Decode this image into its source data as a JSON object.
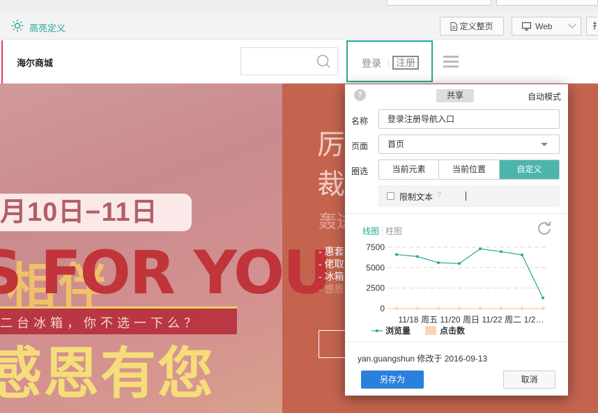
{
  "toolbar": {
    "highlight_label": "高亮定义",
    "define_page_label": "定义整页",
    "platform_label": "Web",
    "extra_label": "扌"
  },
  "site": {
    "logo_text": "海尔商城",
    "login_label": "登录",
    "register_label": "注册"
  },
  "banner": {
    "date_text": "月10日−11日",
    "slogan_en": "S FOR YOU",
    "slogan_cn_top": "相伴",
    "band_text": "二台冰箱，你不选一下么？",
    "slogan_cn_bottom": "感恩有您",
    "right_big1": "厉",
    "right_big2": "裁",
    "right_sub": "轰进",
    "right_list": [
      "- 惠套",
      "- 佬取",
      "- 冰箱",
      "- 感恩"
    ]
  },
  "popup": {
    "help_glyph": "?",
    "share_tab": "共享",
    "auto_mode": "自动模式",
    "name_label": "名称",
    "name_value": "登录注册导航入口",
    "page_label": "页面",
    "page_value": "首页",
    "select_label": "圈选",
    "segments": [
      "当前元素",
      "当前位置",
      "自定义"
    ],
    "limit_text_label": "限制文本",
    "limit_help": "?",
    "chart_tab_line": "线图",
    "chart_tab_bar": "柱图",
    "meta_text": "yan.guangshun 修改于 2016-09-13",
    "save_as_label": "另存为",
    "cancel_label": "取消"
  },
  "colors": {
    "accent": "#26a69a",
    "primary_button": "#2b7fdd",
    "line_series": "#26a69a",
    "bar_series": "#fbd3b4"
  },
  "chart_data": {
    "type": "line",
    "categories": [
      "11/18",
      "周五",
      "11/20",
      "周日",
      "11/22",
      "周二",
      "1/2…"
    ],
    "yticks": [
      0,
      2500,
      5000,
      7500
    ],
    "ylim": [
      0,
      8000
    ],
    "grid": true,
    "legend_placement": "bottom",
    "series": [
      {
        "name": "浏览量",
        "type": "line",
        "values": [
          6600,
          6350,
          5600,
          5500,
          7300,
          6950,
          6550,
          1300
        ]
      },
      {
        "name": "点击数",
        "type": "bar",
        "values": [
          0,
          0,
          0,
          0,
          0,
          0,
          0,
          0
        ]
      }
    ]
  }
}
